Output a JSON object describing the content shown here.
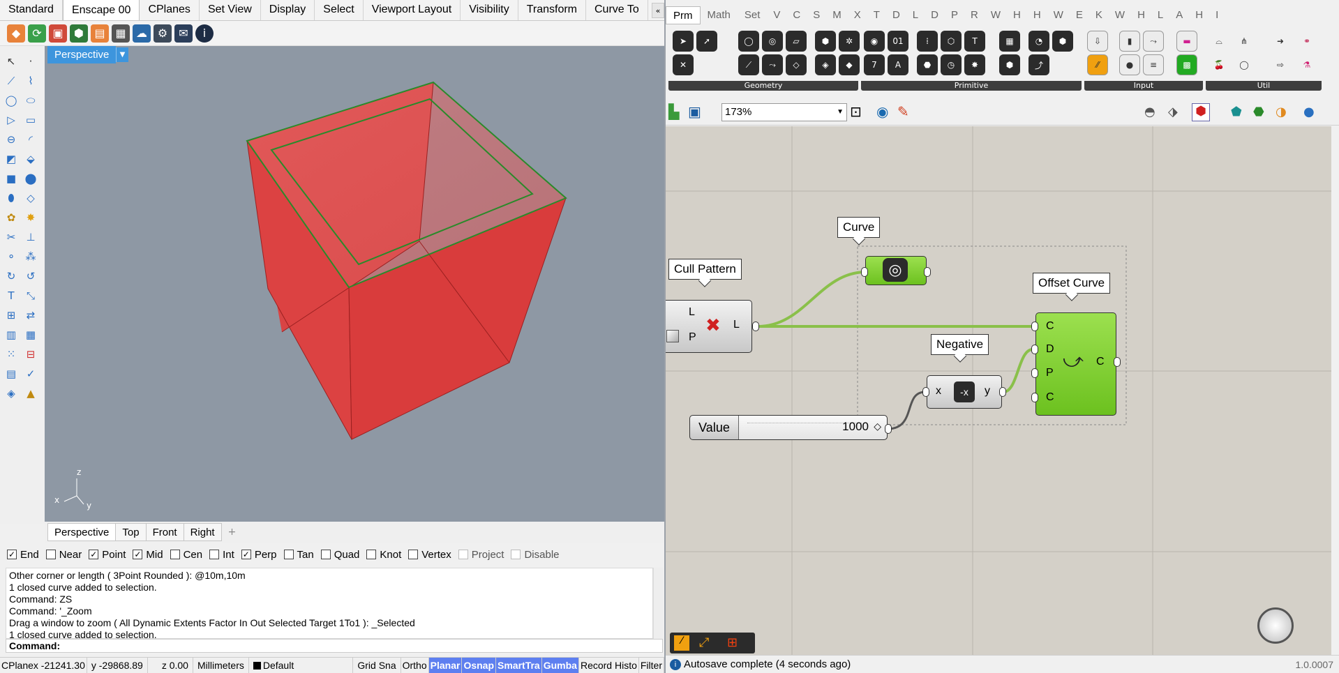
{
  "rhino": {
    "tabs": [
      "Standard",
      "Enscape 00",
      "CPlanes",
      "Set View",
      "Display",
      "Select",
      "Viewport Layout",
      "Visibility",
      "Transform",
      "Curve To"
    ],
    "tabs_overflow": "«",
    "viewport": {
      "title": "Perspective",
      "axis_z": "z",
      "axis_x": "x",
      "axis_y": "y"
    },
    "view_tabs": [
      "Perspective",
      "Top",
      "Front",
      "Right"
    ],
    "osnaps": [
      {
        "label": "End",
        "checked": "✓"
      },
      {
        "label": "Near",
        "checked": ""
      },
      {
        "label": "Point",
        "checked": "✓"
      },
      {
        "label": "Mid",
        "checked": "✓"
      },
      {
        "label": "Cen",
        "checked": ""
      },
      {
        "label": "Int",
        "checked": ""
      },
      {
        "label": "Perp",
        "checked": "✓"
      },
      {
        "label": "Tan",
        "checked": ""
      },
      {
        "label": "Quad",
        "checked": ""
      },
      {
        "label": "Knot",
        "checked": ""
      },
      {
        "label": "Vertex",
        "checked": ""
      },
      {
        "label": "Project",
        "checked": ""
      },
      {
        "label": "Disable",
        "checked": ""
      }
    ],
    "command_history": [
      "Other corner or length ( 3Point  Rounded ): @10m,10m",
      "1 closed curve added to selection.",
      "Command: ZS",
      "Command: '_Zoom",
      "Drag a window to zoom ( All  Dynamic  Extents  Factor  In  Out  Selected  Target  1To1 ): _Selected",
      "1 closed curve added to selection."
    ],
    "command_prompt": "Command:",
    "status": {
      "cplane": "CPlanex -21241.30",
      "y": "y -29868.89",
      "z": "z 0.00",
      "units": "Millimeters",
      "layer": "Default",
      "grid_snap": "Grid Sna",
      "ortho": "Ortho",
      "planar": "Planar",
      "osnap": "Osnap",
      "smarttrack": "SmartTra",
      "gumball": "Gumba",
      "record": "Record Histo",
      "filter": "Filter"
    }
  },
  "gh": {
    "tabs": [
      "Prm",
      "Math",
      "Set",
      "V",
      "C",
      "S",
      "M",
      "X",
      "T",
      "D",
      "L",
      "D",
      "P",
      "R",
      "W",
      "H",
      "H",
      "W",
      "E",
      "K",
      "W",
      "H",
      "L",
      "A",
      "H",
      "I"
    ],
    "panels": [
      "Geometry",
      "Primitive",
      "Input",
      "Util"
    ],
    "zoom": "173%",
    "components": {
      "cull_pattern": {
        "title": "Cull Pattern",
        "in1": "L",
        "in2": "P",
        "out": "L"
      },
      "curve": {
        "title": "Curve"
      },
      "offset_curve": {
        "title": "Offset Curve",
        "in": [
          "C",
          "D",
          "P",
          "C"
        ],
        "out": "C"
      },
      "negative": {
        "title": "Negative",
        "in": "x",
        "out": "y"
      },
      "value": {
        "label": "Value",
        "number": "1000"
      }
    },
    "status": "Autosave complete (4 seconds ago)",
    "version": "1.0.0007"
  },
  "colors": {
    "accent": "#3d95dd",
    "gh_green": "#7fd033",
    "box_red": "#e03c3c"
  }
}
